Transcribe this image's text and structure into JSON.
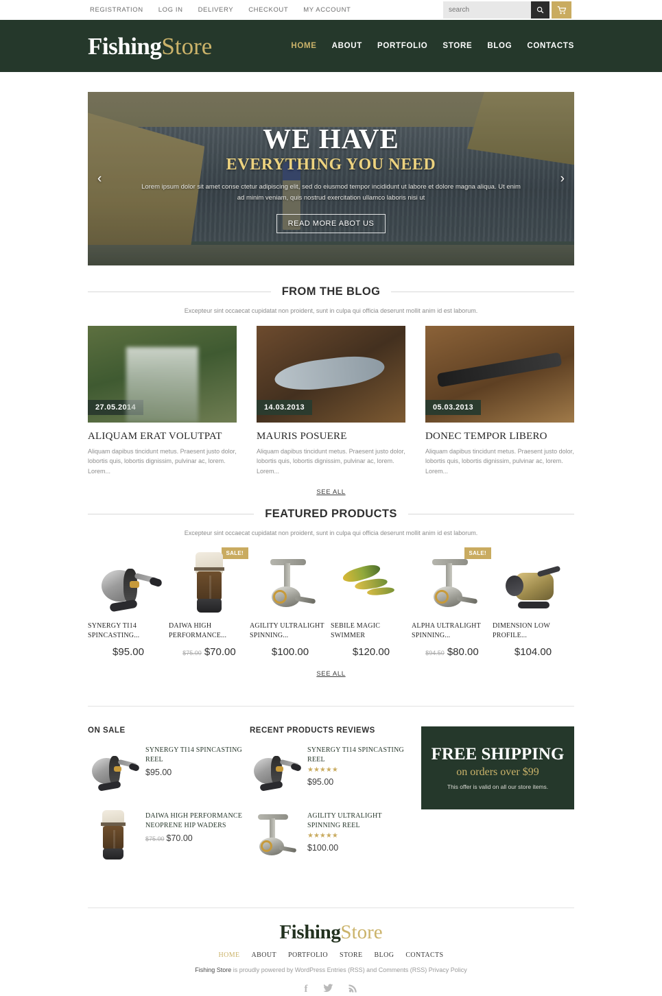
{
  "topbar": {
    "links": [
      "REGISTRATION",
      "LOG IN",
      "DELIVERY",
      "CHECKOUT",
      "MY ACCOUNT"
    ],
    "search_placeholder": "search",
    "search_value": "",
    "search_icon": "search-icon",
    "cart_icon": "cart-icon"
  },
  "header": {
    "logo_first": "Fishing",
    "logo_second": "Store",
    "nav": [
      {
        "label": "HOME",
        "active": true
      },
      {
        "label": "ABOUT",
        "active": false
      },
      {
        "label": "PORTFOLIO",
        "active": false
      },
      {
        "label": "STORE",
        "active": false
      },
      {
        "label": "BLOG",
        "active": false
      },
      {
        "label": "CONTACTS",
        "active": false
      }
    ]
  },
  "hero": {
    "title": "WE HAVE",
    "subtitle": "EVERYTHING YOU NEED",
    "text": "Lorem ipsum dolor sit amet conse ctetur adipiscing elit, sed do eiusmod tempor incididunt ut labore et dolore magna aliqua. Ut enim ad minim veniam, quis nostrud exercitation ullamco laboris nisi ut",
    "button": "READ MORE ABOT US",
    "prev_arrow": "‹",
    "next_arrow": "›"
  },
  "blog": {
    "heading": "FROM THE BLOG",
    "subtitle": "Excepteur sint occaecat cupidatat non proident, sunt in culpa qui officia deserunt mollit anim id est laborum.",
    "see_all": "SEE ALL",
    "posts": [
      {
        "date": "27.05.2014",
        "title": "ALIQUAM ERAT VOLUTPAT",
        "excerpt": "Aliquam dapibus tincidunt metus. Praesent justo dolor, lobortis quis, lobortis dignissim, pulvinar ac, lorem. Lorem..."
      },
      {
        "date": "14.03.2013",
        "title": "MAURIS POSUERE",
        "excerpt": "Aliquam dapibus tincidunt metus. Praesent justo dolor, lobortis quis, lobortis dignissim, pulvinar ac, lorem. Lorem..."
      },
      {
        "date": "05.03.2013",
        "title": "DONEC TEMPOR LIBERO",
        "excerpt": "Aliquam dapibus tincidunt metus. Praesent justo dolor, lobortis quis, lobortis dignissim, pulvinar ac, lorem. Lorem..."
      }
    ]
  },
  "featured": {
    "heading": "FEATURED PRODUCTS",
    "subtitle": "Excepteur sint occaecat cupidatat non proident, sunt in culpa qui officia deserunt mollit anim id est laborum.",
    "see_all": "SEE ALL",
    "sale_badge": "SALE!",
    "products": [
      {
        "name": "SYNERGY TI14 SPINCASTING...",
        "price": "$95.00",
        "old_price": "",
        "sale": false
      },
      {
        "name": "DAIWA HIGH PERFORMANCE...",
        "price": "$70.00",
        "old_price": "$75.00",
        "sale": true
      },
      {
        "name": "AGILITY ULTRALIGHT SPINNING...",
        "price": "$100.00",
        "old_price": "",
        "sale": false
      },
      {
        "name": "SEBILE MAGIC SWIMMER",
        "price": "$120.00",
        "old_price": "",
        "sale": false
      },
      {
        "name": "ALPHA ULTRALIGHT SPINNING...",
        "price": "$80.00",
        "old_price": "$94.50",
        "sale": true
      },
      {
        "name": "DIMENSION LOW PROFILE...",
        "price": "$104.00",
        "old_price": "",
        "sale": false
      }
    ]
  },
  "on_sale": {
    "title": "ON SALE",
    "items": [
      {
        "name": "SYNERGY TI14 SPINCASTING REEL",
        "price": "$95.00",
        "old_price": ""
      },
      {
        "name": "DAIWA HIGH PERFORMANCE NEOPRENE HIP WADERS",
        "price": "$70.00",
        "old_price": "$75.00"
      }
    ]
  },
  "reviews": {
    "title": "RECENT PRODUCTS REVIEWS",
    "items": [
      {
        "name": "SYNERGY TI14 SPINCASTING REEL",
        "stars": "★★★★★",
        "price": "$95.00"
      },
      {
        "name": "AGILITY ULTRALIGHT SPINNING REEL",
        "stars": "★★★★★",
        "price": "$100.00"
      }
    ]
  },
  "shipping": {
    "line1": "FREE SHIPPING",
    "line2": "on orders over $99",
    "line3": "This offer is valid on all our store items."
  },
  "footer": {
    "logo_first": "Fishing",
    "logo_second": "Store",
    "nav": [
      {
        "label": "HOME",
        "active": true
      },
      {
        "label": "ABOUT",
        "active": false
      },
      {
        "label": "PORTFOLIO",
        "active": false
      },
      {
        "label": "STORE",
        "active": false
      },
      {
        "label": "BLOG",
        "active": false
      },
      {
        "label": "CONTACTS",
        "active": false
      }
    ],
    "copyright_brand": "Fishing Store",
    "copyright_rest": " is proudly powered by WordPress Entries (RSS) and Comments (RSS) Privacy Policy",
    "social": [
      {
        "icon": "facebook-icon",
        "glyph": "f"
      },
      {
        "icon": "twitter-icon",
        "glyph": "ᵨ"
      },
      {
        "icon": "rss-icon",
        "glyph": "ʀ"
      }
    ]
  },
  "colors": {
    "brand_green": "#25382b",
    "brand_gold": "#cbb36a",
    "sale_gold": "#c9ab60"
  }
}
